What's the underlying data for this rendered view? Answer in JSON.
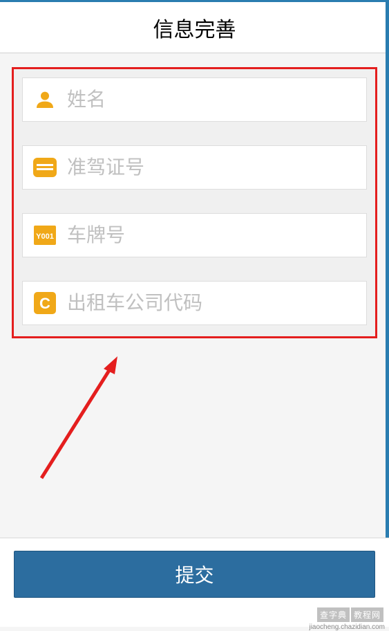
{
  "header": {
    "title": "信息完善"
  },
  "form": {
    "fields": [
      {
        "placeholder": "姓名"
      },
      {
        "placeholder": "准驾证号"
      },
      {
        "placeholder": "车牌号"
      },
      {
        "placeholder": "出租车公司代码"
      }
    ]
  },
  "footer": {
    "submit_label": "提交"
  },
  "icons": {
    "plate_badge": "Y001",
    "company_letter": "C"
  },
  "watermark": {
    "left": "查字典",
    "right": "教程网",
    "url": "jiaocheng.chazidian.com"
  },
  "colors": {
    "accent": "#2a7db0",
    "icon": "#f0a818",
    "highlight_border": "#e41e1e"
  }
}
